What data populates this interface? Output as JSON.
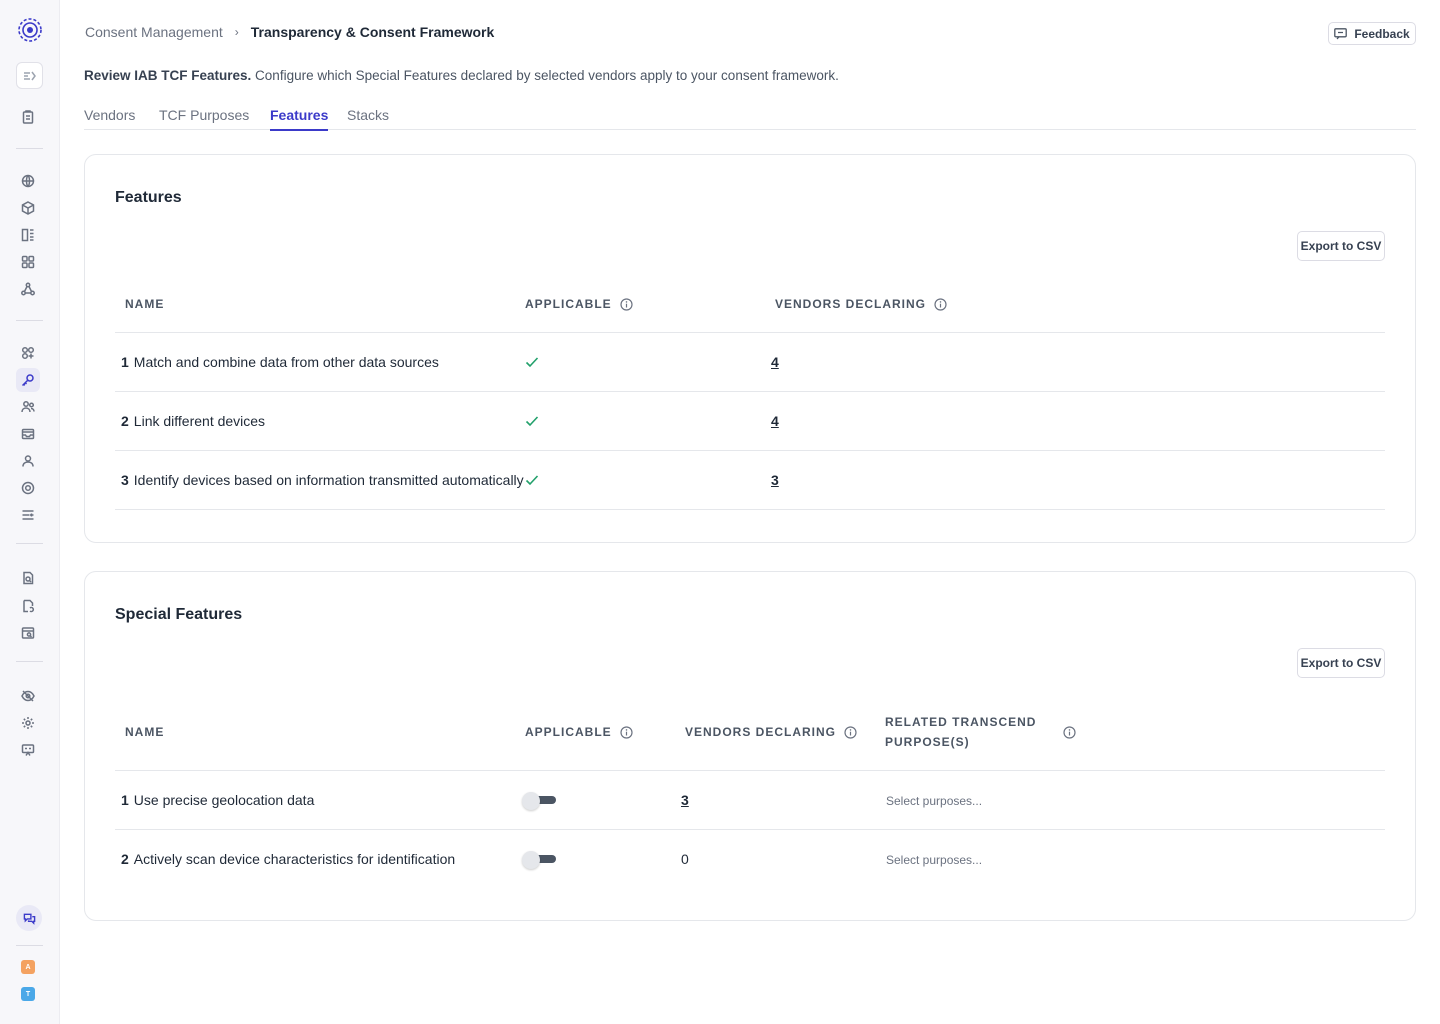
{
  "breadcrumb": {
    "parent": "Consent Management",
    "separator": "›",
    "current": "Transparency & Consent Framework"
  },
  "header": {
    "feedback_label": "Feedback"
  },
  "intro": {
    "bold": "Review IAB TCF Features.",
    "text": " Configure which Special Features declared by selected vendors apply to your consent framework."
  },
  "tabs": [
    {
      "label": "Vendors",
      "active": false
    },
    {
      "label": "TCF Purposes",
      "active": false
    },
    {
      "label": "Features",
      "active": true
    },
    {
      "label": "Stacks",
      "active": false
    }
  ],
  "features": {
    "title": "Features",
    "export_label": "Export to CSV",
    "columns": {
      "name": "NAME",
      "applicable": "APPLICABLE",
      "vendors": "VENDORS DECLARING"
    },
    "rows": [
      {
        "num": "1",
        "name": "Match and combine data from other data sources",
        "applicable": true,
        "vendors": "4"
      },
      {
        "num": "2",
        "name": "Link different devices",
        "applicable": true,
        "vendors": "4"
      },
      {
        "num": "3",
        "name": "Identify devices based on information transmitted automatically",
        "applicable": true,
        "vendors": "3"
      }
    ]
  },
  "special_features": {
    "title": "Special Features",
    "export_label": "Export to CSV",
    "columns": {
      "name": "NAME",
      "applicable": "APPLICABLE",
      "vendors": "VENDORS DECLARING",
      "purposes_line1": "RELATED TRANSCEND",
      "purposes_line2": "PURPOSE(S)"
    },
    "rows": [
      {
        "num": "1",
        "name": "Use precise geolocation data",
        "applicable": false,
        "vendors": "3",
        "purposes_placeholder": "Select purposes..."
      },
      {
        "num": "2",
        "name": "Actively scan device characteristics for identification",
        "applicable": false,
        "vendors": "0",
        "purposes_placeholder": "Select purposes..."
      }
    ]
  },
  "sidebar": {
    "avatars": [
      {
        "letter": "A",
        "color": "#f4a261"
      },
      {
        "letter": "T",
        "color": "#4aa8e8"
      }
    ]
  }
}
